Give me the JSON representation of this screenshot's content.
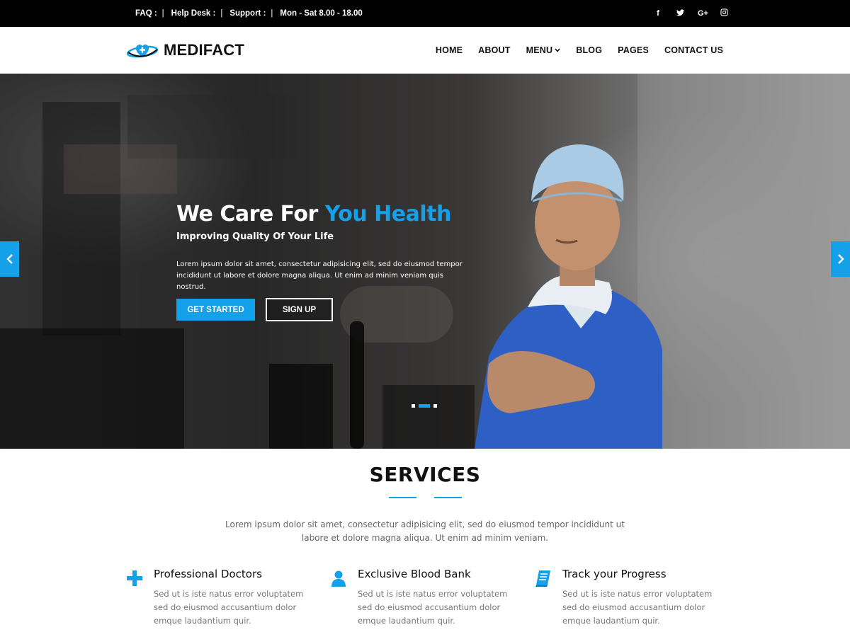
{
  "topbar": {
    "items": [
      "FAQ :",
      "Help Desk :",
      "Support :",
      "Mon - Sat 8.00 - 18.00"
    ],
    "separator": "|",
    "social": [
      "f",
      "twitter-icon",
      "G+",
      "instagram-icon"
    ]
  },
  "header": {
    "logo_text": "MEDIFACT",
    "nav": [
      "HOME",
      "ABOUT",
      "MENU",
      "BLOG",
      "PAGES",
      "CONTACT US"
    ]
  },
  "hero": {
    "title_part1": "We Care For ",
    "title_accent": "You Health",
    "subtitle": "Improving Quality Of Your Life",
    "text": "Lorem ipsum dolor sit amet, consectetur adipisicing elit, sed do eiusmod tempor incididunt ut labore et dolore magna aliqua. Ut enim ad minim veniam quis nostrud.",
    "primary_button": "GET STARTED",
    "secondary_button": "SIGN UP",
    "slides": 3,
    "active_slide": 2
  },
  "services": {
    "title": "SERVICES",
    "description": "Lorem ipsum dolor sit amet, consectetur adipisicing elit, sed do eiusmod tempor incididunt ut labore et dolore magna aliqua. Ut enim ad minim veniam.",
    "items": [
      {
        "icon": "plus-icon",
        "title": "Professional Doctors",
        "text": "Sed ut is iste natus error voluptatem sed do eiusmod accusantium dolor emque laudantium quir."
      },
      {
        "icon": "user-icon",
        "title": "Exclusive Blood Bank",
        "text": "Sed ut is iste natus error voluptatem sed do eiusmod accusantium dolor emque laudantium quir."
      },
      {
        "icon": "book-icon",
        "title": "Track your Progress",
        "text": "Sed ut is iste natus error voluptatem sed do eiusmod accusantium dolor emque laudantium quir."
      }
    ]
  },
  "colors": {
    "accent": "#15a0ea",
    "topbar": "#000000",
    "text": "#111111",
    "muted": "#777777"
  }
}
